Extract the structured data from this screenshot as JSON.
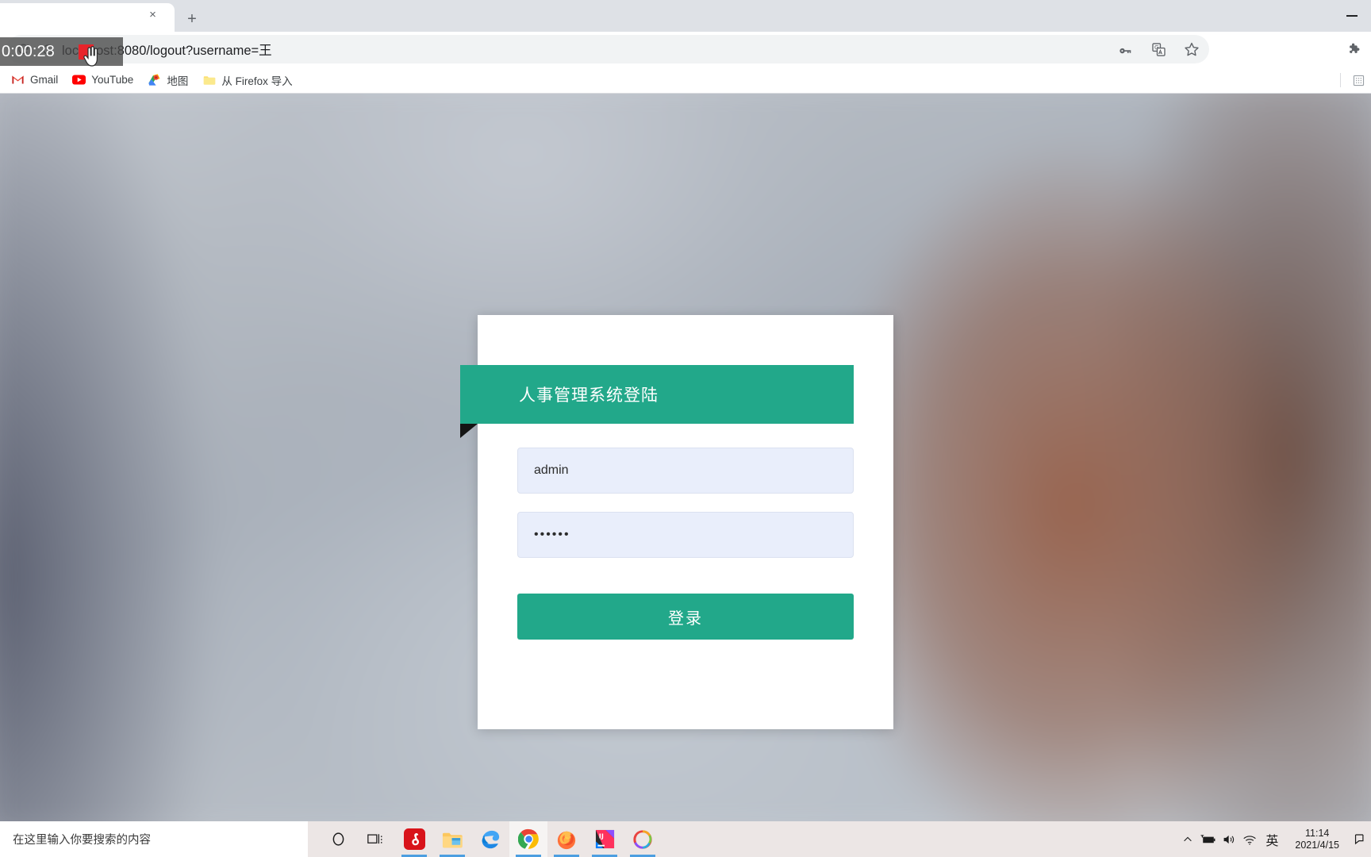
{
  "browser": {
    "tab": {
      "title": "",
      "close_label": "×",
      "new_tab_label": "+"
    },
    "window": {
      "minimize_label": "—"
    },
    "omnibox": {
      "url": "localhost:8080/logout?username=王",
      "reload_icon": "reload-icon",
      "info_icon": "page-info-icon"
    },
    "toolbar_icons": [
      {
        "name": "password-key-icon"
      },
      {
        "name": "google-translate-icon"
      },
      {
        "name": "bookmark-star-icon"
      },
      {
        "name": "extensions-puzzle-icon"
      }
    ],
    "bookmarks": [
      {
        "label": "Gmail",
        "icon": "gmail-icon"
      },
      {
        "label": "YouTube",
        "icon": "youtube-icon"
      },
      {
        "label": "地图",
        "icon": "google-maps-icon"
      },
      {
        "label": "从 Firefox 导入",
        "icon": "folder-icon"
      }
    ],
    "bookmarks_right": [
      {
        "name": "reading-list-icon"
      }
    ]
  },
  "recorder": {
    "elapsed": "0:00:28",
    "stop_color": "#e8232a"
  },
  "login": {
    "title": "人事管理系统登陆",
    "username_value": "admin",
    "username_placeholder": "",
    "password_value": "••••••",
    "password_placeholder": "",
    "submit_label": "登录",
    "accent_color": "#22a88a",
    "field_bg": "#e9eefb"
  },
  "taskbar": {
    "search_placeholder": "在这里输入你要搜索的内容",
    "items": [
      {
        "name": "cortana-icon",
        "running": false,
        "active": false
      },
      {
        "name": "task-view-icon",
        "running": false,
        "active": false
      },
      {
        "name": "netease-music-icon",
        "running": true,
        "active": false
      },
      {
        "name": "file-explorer-icon",
        "running": true,
        "active": false
      },
      {
        "name": "microsoft-edge-icon",
        "running": false,
        "active": false
      },
      {
        "name": "google-chrome-icon",
        "running": true,
        "active": true
      },
      {
        "name": "firefox-icon",
        "running": true,
        "active": false
      },
      {
        "name": "intellij-idea-icon",
        "running": true,
        "active": false
      },
      {
        "name": "photos-icon",
        "running": true,
        "active": false
      }
    ],
    "tray": [
      {
        "name": "show-hidden-icons-chevron"
      },
      {
        "name": "battery-charging-icon"
      },
      {
        "name": "volume-speaker-icon"
      },
      {
        "name": "wifi-icon"
      }
    ],
    "ime_label": "英",
    "clock_time": "11:14",
    "clock_date": "2021/4/15",
    "notification_icon": "notification-center-icon"
  }
}
